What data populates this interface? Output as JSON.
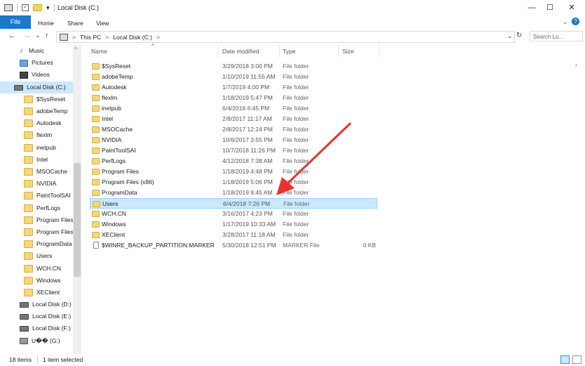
{
  "window": {
    "title": "Local Disk (C:)",
    "minimize_icon": "—",
    "maximize_icon": "☐",
    "close_icon": "✕"
  },
  "quick_access": {
    "dropdown": "▾"
  },
  "ribbon": {
    "tabs": [
      "File",
      "Home",
      "Share",
      "View"
    ],
    "collapse_icon": "⌄",
    "help_icon": "?"
  },
  "address": {
    "back": "←",
    "forward": "→",
    "recent": "⌄",
    "up": "↑",
    "path": [
      "This PC",
      ">",
      "Local Disk (C:)",
      ">"
    ],
    "dropdown": "⌄",
    "refresh": "↻",
    "search_placeholder": "Search Lo...",
    "search_icon": "⌕"
  },
  "nav_pane": {
    "items": [
      {
        "label": "Music",
        "icon": "music-icon"
      },
      {
        "label": "Pictures",
        "icon": "pictures-icon"
      },
      {
        "label": "Videos",
        "icon": "videos-icon"
      },
      {
        "label": "Local Disk (C:)",
        "icon": "drive-icon",
        "selected": true
      },
      {
        "label": "$SysReset",
        "icon": "folder-icon"
      },
      {
        "label": "adobeTemp",
        "icon": "folder-icon"
      },
      {
        "label": "Autodesk",
        "icon": "folder-icon"
      },
      {
        "label": "flexlm",
        "icon": "folder-icon"
      },
      {
        "label": "inetpub",
        "icon": "folder-icon"
      },
      {
        "label": "Intel",
        "icon": "folder-icon"
      },
      {
        "label": "MSOCache",
        "icon": "folder-icon"
      },
      {
        "label": "NVIDIA",
        "icon": "folder-icon"
      },
      {
        "label": "PaintToolSAI",
        "icon": "folder-icon"
      },
      {
        "label": "PerfLogs",
        "icon": "folder-icon"
      },
      {
        "label": "Program Files",
        "icon": "folder-icon"
      },
      {
        "label": "Program Files (",
        "icon": "folder-icon"
      },
      {
        "label": "ProgramData",
        "icon": "folder-icon"
      },
      {
        "label": "Users",
        "icon": "folder-icon"
      },
      {
        "label": "WCH.CN",
        "icon": "folder-icon"
      },
      {
        "label": "Windows",
        "icon": "folder-icon"
      },
      {
        "label": "XEClient",
        "icon": "folder-icon"
      },
      {
        "label": "Local Disk (D:)",
        "icon": "drive-icon"
      },
      {
        "label": "Local Disk (E:)",
        "icon": "drive-icon"
      },
      {
        "label": "Local Disk (F:)",
        "icon": "drive-icon"
      },
      {
        "label": "U�� (G:)",
        "icon": "usb-icon"
      }
    ],
    "scroll_up": "^"
  },
  "columns": {
    "name": "Name",
    "date": "Date modified",
    "type": "Type",
    "size": "Size",
    "sort_indicator": "^"
  },
  "files": [
    {
      "name": "$SysReset",
      "date": "3/29/2018 3:00 PM",
      "type": "File folder",
      "size": ""
    },
    {
      "name": "adobeTemp",
      "date": "1/10/2019 11:55 AM",
      "type": "File folder",
      "size": ""
    },
    {
      "name": "Autodesk",
      "date": "1/7/2019 4:00 PM",
      "type": "File folder",
      "size": ""
    },
    {
      "name": "flexlm",
      "date": "1/18/2019 5:47 PM",
      "type": "File folder",
      "size": ""
    },
    {
      "name": "inetpub",
      "date": "6/4/2018 6:45 PM",
      "type": "File folder",
      "size": ""
    },
    {
      "name": "Intel",
      "date": "2/8/2017 11:17 AM",
      "type": "File folder",
      "size": ""
    },
    {
      "name": "MSOCache",
      "date": "2/8/2017 12:24 PM",
      "type": "File folder",
      "size": ""
    },
    {
      "name": "NVIDIA",
      "date": "10/6/2017 3:55 PM",
      "type": "File folder",
      "size": ""
    },
    {
      "name": "PaintToolSAI",
      "date": "10/7/2018 11:26 PM",
      "type": "File folder",
      "size": ""
    },
    {
      "name": "PerfLogs",
      "date": "4/12/2018 7:38 AM",
      "type": "File folder",
      "size": ""
    },
    {
      "name": "Program Files",
      "date": "1/18/2019 4:48 PM",
      "type": "File folder",
      "size": ""
    },
    {
      "name": "Program Files (x86)",
      "date": "1/18/2019 5:06 PM",
      "type": "File folder",
      "size": ""
    },
    {
      "name": "ProgramData",
      "date": "1/18/2019 9:45 AM",
      "type": "File folder",
      "size": ""
    },
    {
      "name": "Users",
      "date": "6/4/2018 7:26 PM",
      "type": "File folder",
      "size": "",
      "selected": true
    },
    {
      "name": "WCH.CN",
      "date": "3/16/2017 4:23 PM",
      "type": "File folder",
      "size": ""
    },
    {
      "name": "Windows",
      "date": "1/17/2019 10:33 AM",
      "type": "File folder",
      "size": ""
    },
    {
      "name": "XEClient",
      "date": "3/28/2017 11:18 AM",
      "type": "File folder",
      "size": ""
    },
    {
      "name": "$WINRE_BACKUP_PARTITION.MARKER",
      "date": "5/30/2018 12:51 PM",
      "type": "MARKER File",
      "size": "0 KB",
      "is_file": true
    }
  ],
  "status": {
    "items": "18 items",
    "selected": "1 item selected"
  },
  "colors": {
    "accent": "#1979ca",
    "selection": "#cce8ff",
    "annotation_arrow": "#e8322d"
  }
}
